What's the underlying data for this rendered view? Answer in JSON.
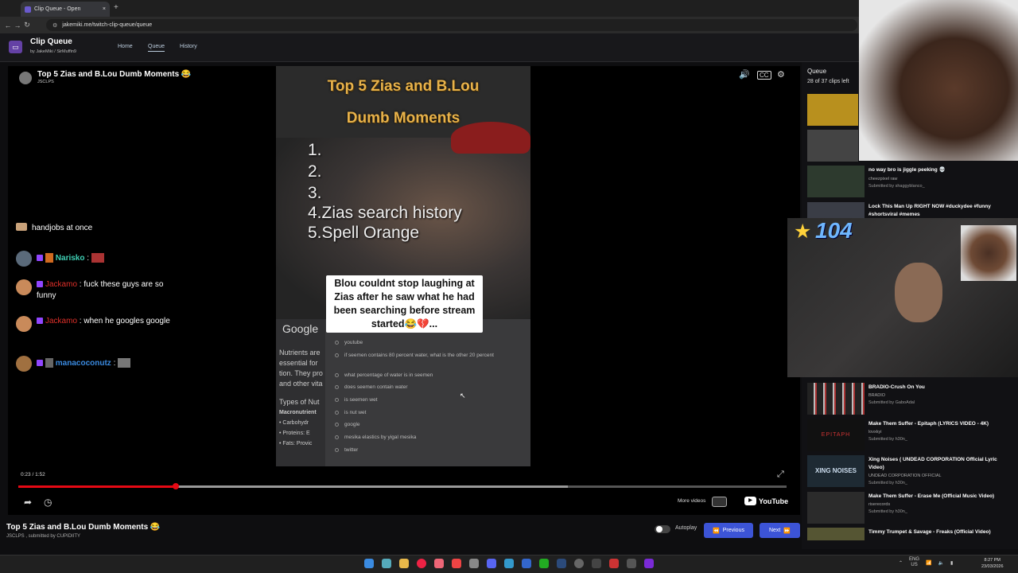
{
  "browser": {
    "tab_title": "Clip Queue - Open",
    "url": "jakemiki.me/twitch-clip-queue/queue"
  },
  "app": {
    "title": "Clip Queue",
    "subtitle": "by JakeMiki / SirMuffin9",
    "nav": [
      "Home",
      "Queue",
      "History"
    ]
  },
  "player": {
    "title": "Top 5 Zias and B.Lou Dumb Moments 😂",
    "channel": "JSCLPS",
    "time": "0:23 / 1:52",
    "progress": 0.205,
    "buffered": 0.715,
    "more_videos": "More videos",
    "youtube": "YouTube",
    "video": {
      "heading": [
        "Top 5 Zias and B.Lou",
        "Dumb Moments"
      ],
      "list": [
        "1.",
        "2.",
        "3.",
        "4.Zias search history",
        "5.Spell Orange"
      ],
      "caption": "Blou couldnt stop laughing at Zias after he saw what he had been searching before stream started😂💔...",
      "google": "Google",
      "suggestions": [
        "nutrients",
        "youtube",
        "if seemen contains 80 percent water, what is the other 20 percent",
        "what percentage of water is in seemen",
        "does seemen contain water",
        "is seemen wet",
        "is nut wet",
        "google",
        "mesika elastics by yigal mesika",
        "twitter"
      ],
      "page_text": [
        "Nutrients are",
        "essential for",
        "tion. They pro",
        "and other vita",
        "Types of Nut",
        "Macronutrient",
        "• Carbohydr",
        "• Proteins: E",
        "• Fats: Provic"
      ]
    }
  },
  "chat": [
    {
      "user": "",
      "user_color": "#ffffff",
      "message": "handjobs at once"
    },
    {
      "user": "Narisko",
      "user_color": "#3fd0b5",
      "message": ":"
    },
    {
      "user": "Jackamo",
      "user_color": "#e0302a",
      "message": ": fuck these guys are so funny"
    },
    {
      "user": "Jackamo",
      "user_color": "#e0302a",
      "message": ": when he googles google"
    },
    {
      "user": "manacoconutz",
      "user_color": "#3a8ae0",
      "message": ":"
    }
  ],
  "below": {
    "title": "Top 5 Zias and B.Lou Dumb Moments 😂",
    "sub": "JSCLPS , submitted by CUPIDIITY",
    "autoplay": "Autoplay",
    "previous": "Previous",
    "next": "Next"
  },
  "queue": {
    "title": "Queue",
    "left": "28 of 37 clips left",
    "items": [
      {
        "title": "no way bro is jiggle peeking 💀",
        "channel": "cheezpixel raw",
        "submitted": "Submitted by shaggyblanco_"
      },
      {
        "title": "Lock This Man Up RIGHT NOW #duckydee #funny #shortsviral #memes",
        "channel": "",
        "submitted": ""
      },
      {
        "title": "BRADIO-Crush On You",
        "channel": "BRADIO",
        "submitted": "Submitted by GaboAdal"
      },
      {
        "title": "Make Them Suffer - Epitaph (LYRICS VIDEO - 4K)",
        "channel": "lovxkyi",
        "submitted": "Submitted by h30n_"
      },
      {
        "title": "Xing Noises ( UNDEAD CORPORATION Official Lyric Video)",
        "channel": "UNDEAD CORPORATION OFFICIAL",
        "submitted": "Submitted by h30n_"
      },
      {
        "title": "Make Them Suffer - Erase Me (Official Music Video)",
        "channel": "riserecords",
        "submitted": "Submitted by h30n_"
      },
      {
        "title": "Timmy Trumpet & Savage - Freaks (Official Video)",
        "channel": "",
        "submitted": ""
      }
    ],
    "thumb_texts": [
      "",
      "",
      "",
      "",
      "",
      "EPITAPH",
      "XING NOISES",
      ""
    ]
  },
  "overlay": {
    "star_count": "104"
  },
  "taskbar": {
    "lang": "ENG",
    "region": "US",
    "time": "8:27 PM",
    "date": "23/03/2026"
  },
  "colors": {
    "accent": "#3c54d6",
    "progress": "#e50914",
    "brand": "#6441a5"
  }
}
